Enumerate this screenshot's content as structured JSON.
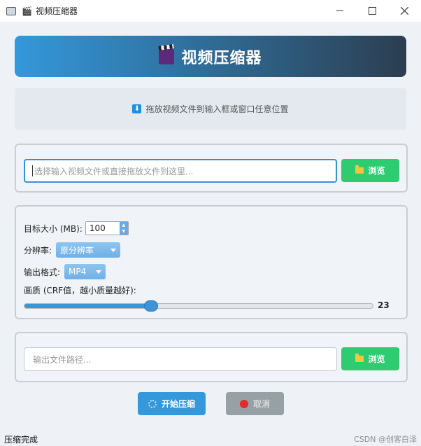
{
  "window": {
    "title": "视频压缩器"
  },
  "header": {
    "title": "视频压缩器"
  },
  "drop_zone": {
    "text": "拖放视频文件到输入框或窗口任意位置"
  },
  "input_section": {
    "placeholder": "选择输入视频文件或直接拖放文件到这里...",
    "browse_label": "浏览"
  },
  "settings": {
    "target_size_label": "目标大小 (MB):",
    "target_size_value": "100",
    "resolution_label": "分辨率:",
    "resolution_value": "原分辨率",
    "format_label": "输出格式:",
    "format_value": "MP4",
    "quality_label": "画质 (CRF值，越小质量越好):",
    "crf_value": "23",
    "crf_min": 0,
    "crf_max": 63
  },
  "output_section": {
    "placeholder": "输出文件路径...",
    "browse_label": "浏览"
  },
  "actions": {
    "start_label": "开始压缩",
    "cancel_label": "取消"
  },
  "status": {
    "text": "压缩完成"
  },
  "watermark": "CSDN @创客白泽",
  "colors": {
    "accent": "#3498db",
    "browse": "#2ecc71",
    "header_start": "#3498db",
    "header_end": "#2c3e50",
    "cancel_disabled": "#97a1a5"
  }
}
